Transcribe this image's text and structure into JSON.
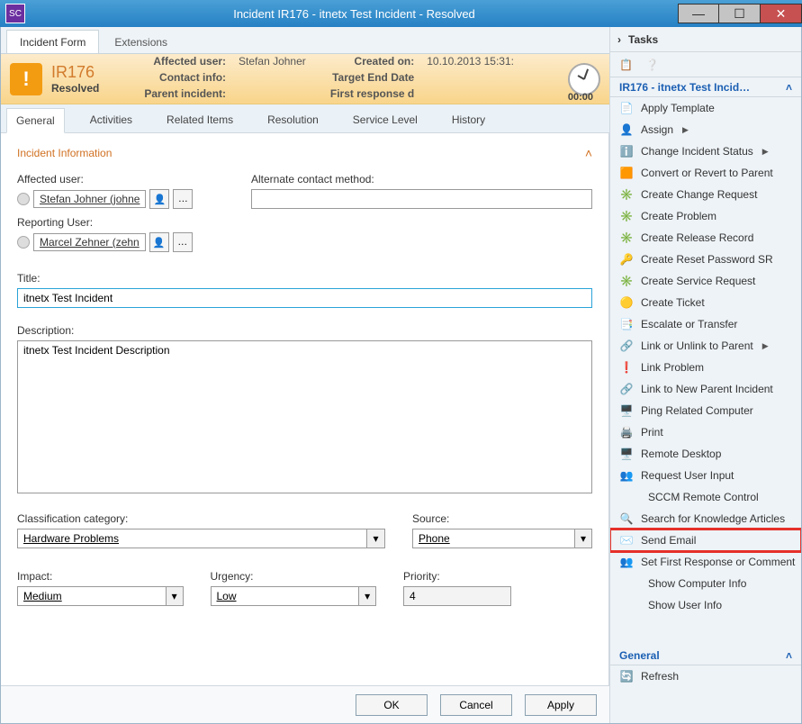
{
  "window": {
    "title": "Incident IR176 - itnetx Test Incident - Resolved",
    "timer": "00:00"
  },
  "topTabs": {
    "incidentForm": "Incident Form",
    "extensions": "Extensions"
  },
  "banner": {
    "id": "IR176",
    "status": "Resolved",
    "affectedUserLabel": "Affected user:",
    "affectedUserValue": "Stefan Johner",
    "contactInfoLabel": "Contact info:",
    "parentIncidentLabel": "Parent incident:",
    "createdOnLabel": "Created on:",
    "createdOnValue": "10.10.2013 15:31:",
    "targetEndLabel": "Target End Date",
    "firstRespLabel": "First response d"
  },
  "innerTabs": [
    "General",
    "Activities",
    "Related Items",
    "Resolution",
    "Service Level",
    "History"
  ],
  "section": {
    "title": "Incident Information"
  },
  "form": {
    "affectedUserLabel": "Affected user:",
    "affectedUserValue": "Stefan Johner (johne",
    "alternateLabel": "Alternate contact method:",
    "alternateValue": "",
    "reportingLabel": "Reporting User:",
    "reportingValue": "Marcel Zehner (zehn",
    "titleLabel": "Title:",
    "titleValue": "itnetx Test Incident",
    "descLabel": "Description:",
    "descValue": "itnetx Test Incident Description",
    "classLabel": "Classification category:",
    "classValue": "Hardware Problems",
    "sourceLabel": "Source:",
    "sourceValue": "Phone",
    "impactLabel": "Impact:",
    "impactValue": "Medium",
    "urgencyLabel": "Urgency:",
    "urgencyValue": "Low",
    "priorityLabel": "Priority:",
    "priorityValue": "4"
  },
  "buttons": {
    "ok": "OK",
    "cancel": "Cancel",
    "apply": "Apply"
  },
  "tasksPanel": {
    "header": "Tasks",
    "groupTitle": "IR176 - itnetx Test Incid…",
    "groupGeneral": "General",
    "refresh": "Refresh",
    "items": [
      {
        "label": "Apply Template",
        "icon": "📄"
      },
      {
        "label": "Assign",
        "icon": "👤",
        "submenu": true
      },
      {
        "label": "Change Incident Status",
        "icon": "ℹ️",
        "submenu": true
      },
      {
        "label": "Convert or Revert to Parent",
        "icon": "🟧"
      },
      {
        "label": "Create Change Request",
        "icon": "✳️"
      },
      {
        "label": "Create Problem",
        "icon": "✳️"
      },
      {
        "label": "Create Release Record",
        "icon": "✳️"
      },
      {
        "label": "Create Reset Password SR",
        "icon": "🔑"
      },
      {
        "label": "Create Service Request",
        "icon": "✳️"
      },
      {
        "label": "Create Ticket",
        "icon": "🟡"
      },
      {
        "label": "Escalate or Transfer",
        "icon": "📑"
      },
      {
        "label": "Link or Unlink to Parent",
        "icon": "🔗",
        "submenu": true
      },
      {
        "label": "Link Problem",
        "icon": "❗"
      },
      {
        "label": "Link to New Parent Incident",
        "icon": "🔗"
      },
      {
        "label": "Ping Related Computer",
        "icon": "🖥️"
      },
      {
        "label": "Print",
        "icon": "🖨️"
      },
      {
        "label": "Remote Desktop",
        "icon": "🖥️"
      },
      {
        "label": "Request User Input",
        "icon": "👥"
      },
      {
        "label": "SCCM Remote Control",
        "icon": ""
      },
      {
        "label": "Search for Knowledge Articles",
        "icon": "🔍"
      },
      {
        "label": "Send Email",
        "icon": "✉️",
        "highlight": true
      },
      {
        "label": "Set First Response or Comment",
        "icon": "👥"
      },
      {
        "label": "Show Computer Info",
        "icon": ""
      },
      {
        "label": "Show User Info",
        "icon": ""
      }
    ]
  }
}
